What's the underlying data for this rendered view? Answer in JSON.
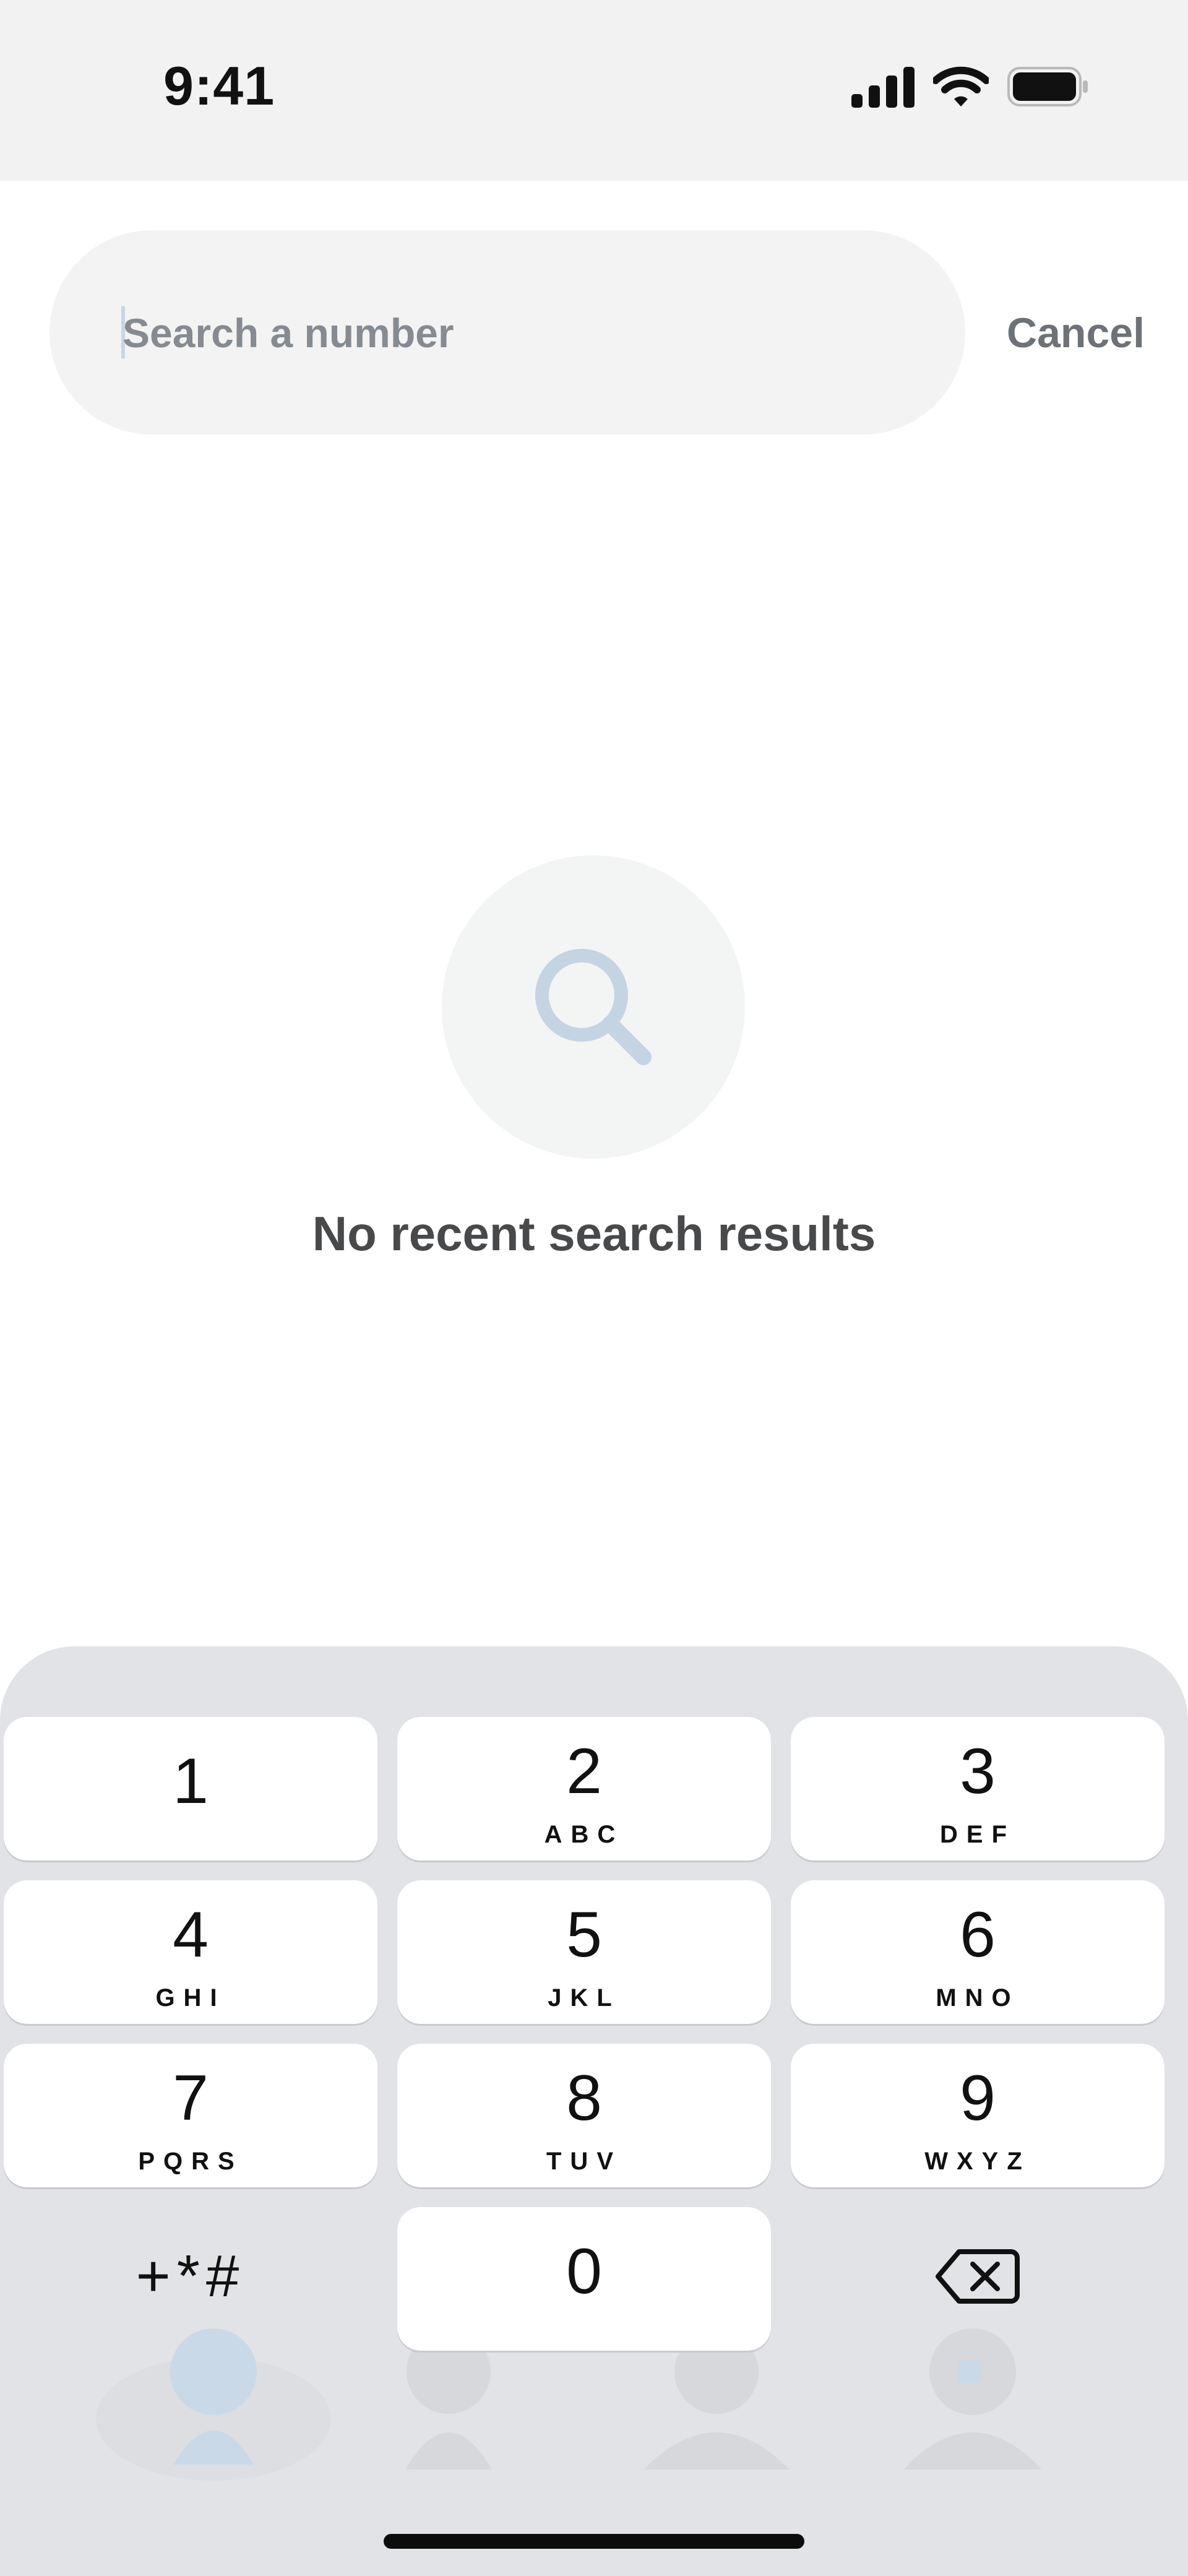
{
  "status_bar": {
    "time": "9:41",
    "icons": [
      "cellular-signal-icon",
      "wifi-icon",
      "battery-icon"
    ]
  },
  "search": {
    "placeholder": "Search a number",
    "value": "",
    "cancel_label": "Cancel"
  },
  "empty_state": {
    "icon": "search-icon",
    "message": "No recent search results"
  },
  "keypad": {
    "keys": [
      {
        "digit": "1",
        "letters": ""
      },
      {
        "digit": "2",
        "letters": "ABC"
      },
      {
        "digit": "3",
        "letters": "DEF"
      },
      {
        "digit": "4",
        "letters": "GHI"
      },
      {
        "digit": "5",
        "letters": "JKL"
      },
      {
        "digit": "6",
        "letters": "MNO"
      },
      {
        "digit": "7",
        "letters": "PQRS"
      },
      {
        "digit": "8",
        "letters": "TUV"
      },
      {
        "digit": "9",
        "letters": "WXYZ"
      },
      {
        "digit": "0",
        "letters": ""
      }
    ],
    "symbols_label": "+*#",
    "delete_icon": "backspace-icon"
  },
  "colors": {
    "status_bar_bg": "#f2f2f2",
    "search_field_bg": "#f3f3f3",
    "caret": "#c7d6e6",
    "empty_icon": "#c5d4e3",
    "keypad_bg": "#e2e3e6",
    "key_bg": "#ffffff",
    "text_primary": "#111111",
    "text_secondary": "#6d7278"
  }
}
